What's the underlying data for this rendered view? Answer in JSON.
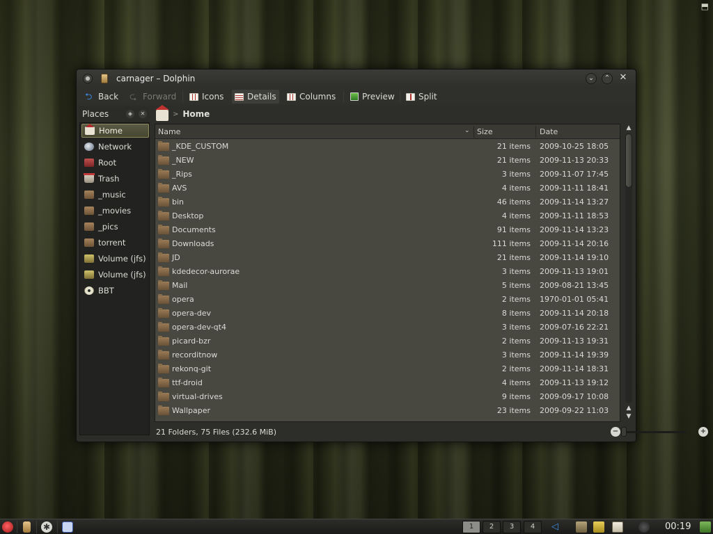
{
  "window": {
    "title": "carnager – Dolphin"
  },
  "toolbar": {
    "back": "Back",
    "forward": "Forward",
    "icons": "Icons",
    "details": "Details",
    "columns": "Columns",
    "preview": "Preview",
    "split": "Split"
  },
  "places": {
    "title": "Places",
    "items": [
      {
        "label": "Home",
        "icon": "home-icon",
        "selected": true
      },
      {
        "label": "Network",
        "icon": "network-icon"
      },
      {
        "label": "Root",
        "icon": "root-folder-icon"
      },
      {
        "label": "Trash",
        "icon": "trash-icon"
      },
      {
        "label": "_music",
        "icon": "folder-icon"
      },
      {
        "label": "_movies",
        "icon": "folder-icon"
      },
      {
        "label": "_pics",
        "icon": "folder-icon"
      },
      {
        "label": "torrent",
        "icon": "folder-icon"
      },
      {
        "label": "Volume (jfs)",
        "icon": "volume-icon"
      },
      {
        "label": "Volume (jfs)",
        "icon": "volume-icon"
      },
      {
        "label": "BBT",
        "icon": "disc-icon"
      }
    ]
  },
  "breadcrumb": {
    "current": "Home",
    "separator": ">"
  },
  "columns": {
    "name": "Name",
    "size": "Size",
    "date": "Date"
  },
  "files": [
    {
      "name": "_KDE_CUSTOM",
      "size": "21 items",
      "date": "2009-10-25 18:05"
    },
    {
      "name": "_NEW",
      "size": "21 items",
      "date": "2009-11-13 20:33"
    },
    {
      "name": "_Rips",
      "size": "3 items",
      "date": "2009-11-07 17:45"
    },
    {
      "name": "AVS",
      "size": "4 items",
      "date": "2009-11-11 18:41"
    },
    {
      "name": "bin",
      "size": "46 items",
      "date": "2009-11-14 13:27"
    },
    {
      "name": "Desktop",
      "size": "4 items",
      "date": "2009-11-11 18:53"
    },
    {
      "name": "Documents",
      "size": "91 items",
      "date": "2009-11-14 13:23"
    },
    {
      "name": "Downloads",
      "size": "111 items",
      "date": "2009-11-14 20:16"
    },
    {
      "name": "JD",
      "size": "21 items",
      "date": "2009-11-14 19:10"
    },
    {
      "name": "kdedecor-aurorae",
      "size": "3 items",
      "date": "2009-11-13 19:01"
    },
    {
      "name": "Mail",
      "size": "5 items",
      "date": "2009-08-21 13:45"
    },
    {
      "name": "opera",
      "size": "2 items",
      "date": "1970-01-01 05:41"
    },
    {
      "name": "opera-dev",
      "size": "8 items",
      "date": "2009-11-14 20:18"
    },
    {
      "name": "opera-dev-qt4",
      "size": "3 items",
      "date": "2009-07-16 22:21"
    },
    {
      "name": "picard-bzr",
      "size": "2 items",
      "date": "2009-11-13 19:31"
    },
    {
      "name": "recorditnow",
      "size": "3 items",
      "date": "2009-11-14 19:39"
    },
    {
      "name": "rekonq-git",
      "size": "2 items",
      "date": "2009-11-14 18:31"
    },
    {
      "name": "ttf-droid",
      "size": "4 items",
      "date": "2009-11-13 19:12"
    },
    {
      "name": "virtual-drives",
      "size": "9 items",
      "date": "2009-09-17 10:08"
    },
    {
      "name": "Wallpaper",
      "size": "23 items",
      "date": "2009-09-22 11:03"
    }
  ],
  "status": {
    "summary": "21 Folders, 75 Files (232.6 MiB)"
  },
  "taskbar": {
    "pager": [
      "1",
      "2",
      "3",
      "4"
    ],
    "active_desktop": 1,
    "clock": "00:19"
  },
  "colors": {
    "selection_border": "#8e8a60",
    "window_bg": "#2d2d2a",
    "view_bg": "#484740"
  }
}
